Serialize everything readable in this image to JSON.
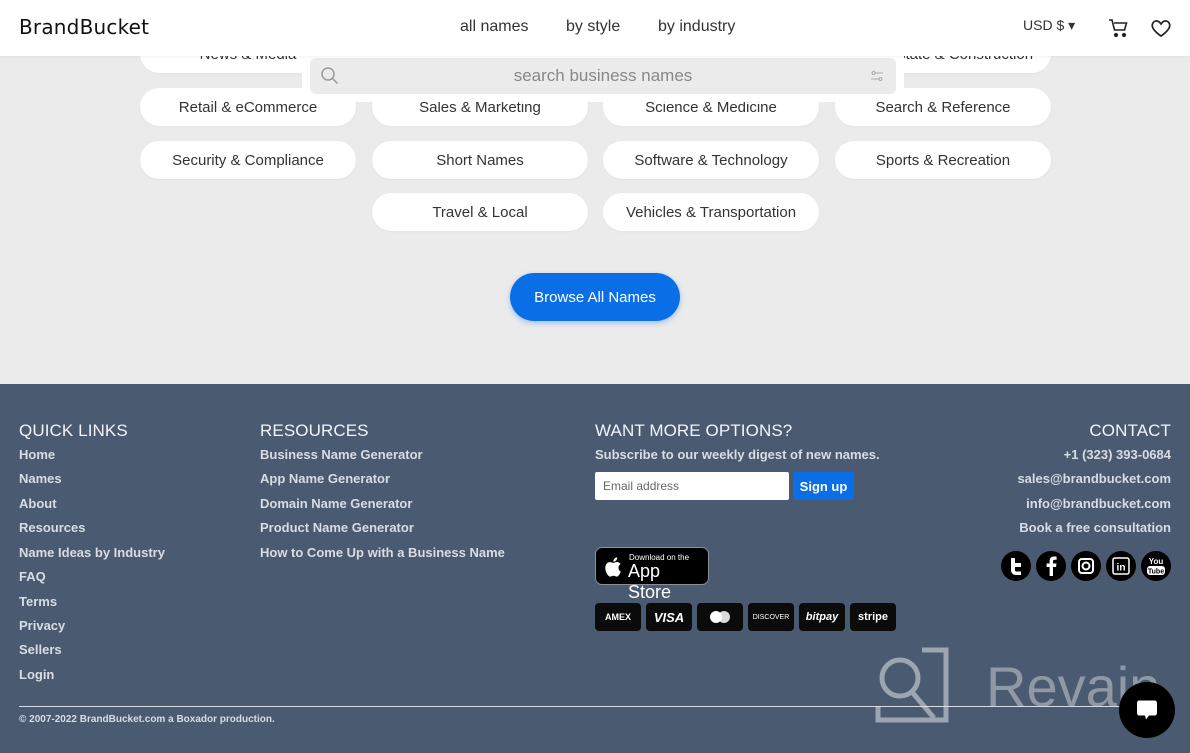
{
  "header": {
    "logo": "BrandBucket",
    "nav": [
      "all names",
      "by style",
      "by industry"
    ],
    "currency": "USD $ ▾",
    "icons": [
      "cart-icon",
      "heart-icon"
    ]
  },
  "search": {
    "placeholder": "search business names"
  },
  "categories": {
    "row0": [
      "News & Media",
      "Real Estate & Construction"
    ],
    "row1": [
      "Retail & eCommerce",
      "Sales & Marketing",
      "Science & Medicine",
      "Search & Reference"
    ],
    "row2": [
      "Security & Compliance",
      "Short Names",
      "Software & Technology",
      "Sports & Recreation"
    ],
    "row3": [
      "Travel & Local",
      "Vehicles & Transportation"
    ]
  },
  "browse_button": "Browse All Names",
  "footer": {
    "quick_links": {
      "title": "QUICK LINKS",
      "items": [
        "Home",
        "Names",
        "About",
        "Resources",
        "Name Ideas by Industry",
        "FAQ",
        "Terms",
        "Privacy",
        "Sellers",
        "Login"
      ]
    },
    "resources": {
      "title": "RESOURCES",
      "items": [
        "Business Name Generator",
        "App Name Generator",
        "Domain Name Generator",
        "Product Name Generator",
        "How to Come Up with a Business Name"
      ]
    },
    "options": {
      "title": "WANT MORE OPTIONS?",
      "subtitle": "Subscribe to our weekly digest of new names.",
      "email_placeholder": "Email address",
      "signup": "Sign up",
      "appstore_small": "Download on the",
      "appstore_big": "App Store",
      "payments": [
        "AMEX",
        "VISA",
        "mastercard",
        "DISCOVER",
        "bitpay",
        "stripe"
      ]
    },
    "contact": {
      "title": "CONTACT",
      "phone": "+1 (323) 393-0684",
      "sales_email": "sales@brandbucket.com",
      "info_email": "info@brandbucket.com",
      "consultation": "Book a free consultation",
      "social": [
        "twitter",
        "facebook",
        "instagram",
        "linkedin",
        "youtube"
      ]
    },
    "copyright": "© 2007-2022 BrandBucket.com a Boxador production."
  },
  "watermark": "Revain",
  "colors": {
    "accent": "#0a6fe6",
    "footer_bg": "#4a5a70",
    "page_bg": "#ebebeb"
  }
}
